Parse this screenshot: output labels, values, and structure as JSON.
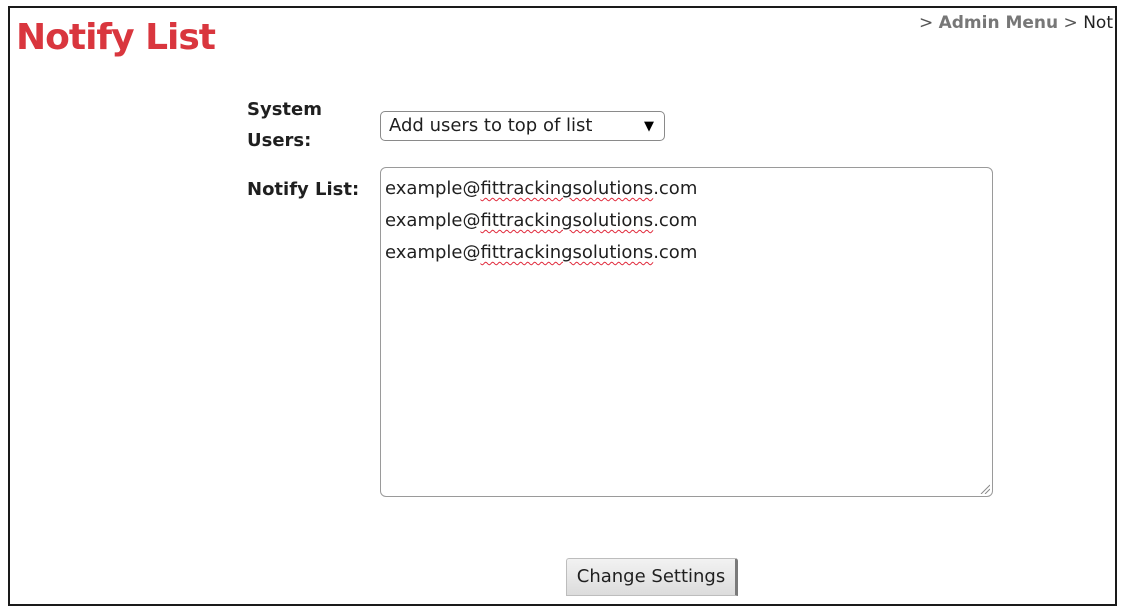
{
  "page": {
    "title": "Notify List"
  },
  "breadcrumb": {
    "separator": ">",
    "items": [
      {
        "label": "Admin Menu"
      },
      {
        "label": "Not"
      }
    ]
  },
  "form": {
    "system_users_label": "System Users:",
    "system_users_select": {
      "selected": "Add users to top of list"
    },
    "notify_list_label": "Notify List:",
    "notify_list_value": [
      "example@fittrackingsolutions.com",
      "example@fittrackingsolutions.com",
      "example@fittrackingsolutions.com"
    ],
    "submit_label": "Change Settings"
  },
  "colors": {
    "title": "#d9363e",
    "breadcrumb_link": "#777777",
    "label_text": "#1f1f1f",
    "frame_border": "#1a1a1a",
    "spellcheck_underline": "#e0283a"
  },
  "icons": {
    "select_arrow": "dropdown-triangle-icon",
    "textarea_resize": "resize-grip-icon"
  }
}
